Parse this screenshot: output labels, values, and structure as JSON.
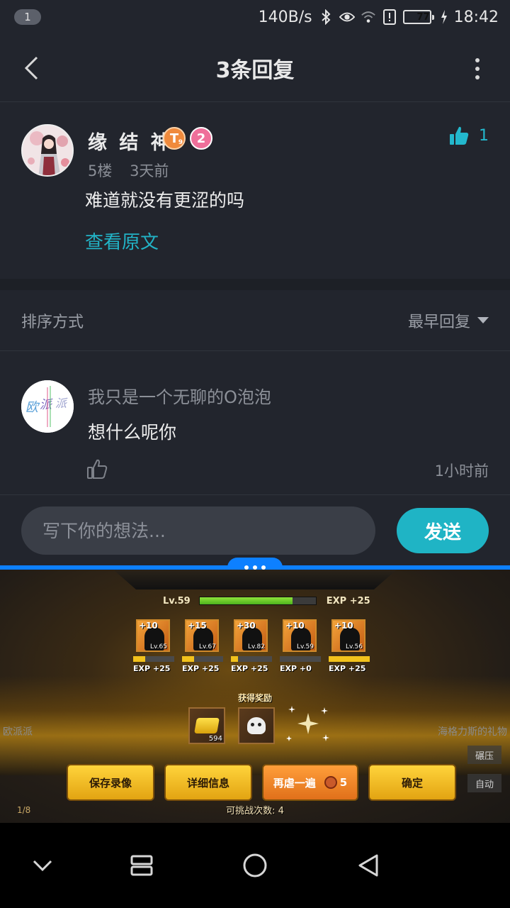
{
  "status_bar": {
    "notification_count": "1",
    "net_speed": "140B/s",
    "battery": "77",
    "time": "18:42",
    "icons": [
      "bluetooth-icon",
      "eye-icon",
      "wifi-icon",
      "alert-icon",
      "battery-icon",
      "charging-icon"
    ]
  },
  "header": {
    "title": "3条回复",
    "back_icon": "chevron-left-icon",
    "more_icon": "more-vertical-icon"
  },
  "main_comment": {
    "author": "缘 结 神",
    "badge_t": "T",
    "badge_t_sub": "9",
    "badge_level": "2",
    "floor": "5楼",
    "time": "3天前",
    "text": "难道就没有更涩的吗",
    "view_original": "查看原文",
    "like_count": "1"
  },
  "sort": {
    "label": "排序方式",
    "value": "最早回复"
  },
  "reply": {
    "author": "我只是一个无聊的O泡泡",
    "text": "想什么呢你",
    "time": "1小时前"
  },
  "input": {
    "placeholder": "写下你的想法...",
    "send_label": "发送"
  },
  "game": {
    "level": "Lv.59",
    "exp_gain": "EXP +25",
    "exp_progress": 0.8,
    "heroes": [
      {
        "plus": "+10",
        "level": "Lv.65",
        "exp": "EXP +25",
        "progress": 0.3
      },
      {
        "plus": "+15",
        "level": "Lv.67",
        "exp": "EXP +25",
        "progress": 0.3
      },
      {
        "plus": "+30",
        "level": "Lv.82",
        "exp": "EXP +25",
        "progress": 0.18
      },
      {
        "plus": "+10",
        "level": "Lv.59",
        "exp": "EXP +0",
        "progress": 0.0
      },
      {
        "plus": "+10",
        "level": "Lv.56",
        "exp": "EXP +25",
        "progress": 1.0
      }
    ],
    "reward_title": "获得奖励",
    "gold_count": "594",
    "left_label": "欧派派",
    "right_label": "海格力斯的礼物",
    "side_buttons": [
      "碾压",
      "自动"
    ],
    "buttons": {
      "save": "保存录像",
      "details": "详细信息",
      "replay": "再虐一遍",
      "replay_cost": "5",
      "confirm": "确定"
    },
    "attempts": "可挑战次数: 4",
    "fraction": "1/8"
  },
  "nav_bar": {
    "icons": [
      "chevron-down-icon",
      "recents-icon",
      "home-icon",
      "back-triangle-icon"
    ]
  }
}
